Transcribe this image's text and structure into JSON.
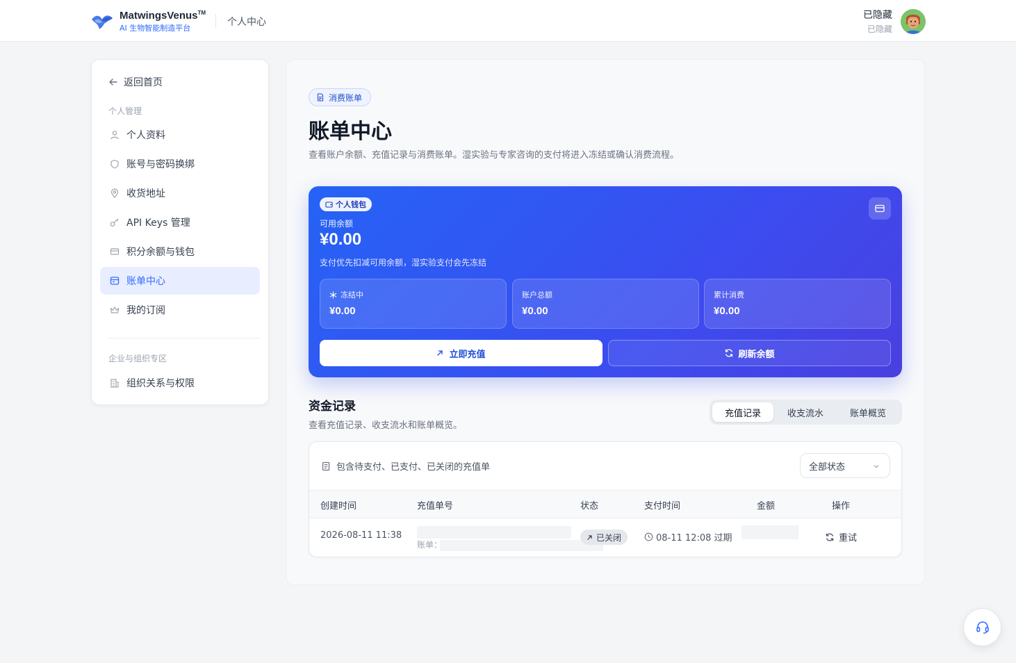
{
  "header": {
    "brand_name": "MatwingsVenus",
    "brand_tm": "TM",
    "brand_sub": "AI 生物智能制造平台",
    "section": "个人中心",
    "user_name": "已隐藏",
    "user_sub": "已隐藏"
  },
  "sidebar": {
    "back": "返回首页",
    "group1": "个人管理",
    "items": [
      {
        "label": "个人资料",
        "icon": "user-icon"
      },
      {
        "label": "账号与密码换绑",
        "icon": "shield-icon"
      },
      {
        "label": "收货地址",
        "icon": "map-pin-icon"
      },
      {
        "label": "API Keys 管理",
        "icon": "key-icon"
      },
      {
        "label": "积分余额与钱包",
        "icon": "credit-card-icon"
      },
      {
        "label": "账单中心",
        "icon": "receipt-icon",
        "active": true
      },
      {
        "label": "我的订阅",
        "icon": "crown-icon"
      }
    ],
    "group2": "企业与组织专区",
    "org_item": {
      "label": "组织关系与权限",
      "icon": "building-icon"
    }
  },
  "main": {
    "tag": "消费账单",
    "title": "账单中心",
    "desc": "查看账户余额、充值记录与消费账单。湿实验与专家咨询的支付将进入冻结或确认消费流程。"
  },
  "wallet": {
    "chip": "个人钱包",
    "balance_label": "可用余额",
    "balance_value": "¥0.00",
    "note": "支付优先扣减可用余额，湿实验支付会先冻结",
    "stats": [
      {
        "label": "冻结中",
        "value": "¥0.00"
      },
      {
        "label": "账户总额",
        "value": "¥0.00"
      },
      {
        "label": "累计消费",
        "value": "¥0.00"
      }
    ],
    "recharge_label": "立即充值",
    "refresh_label": "刷新余额",
    "gradient_start": "#2563f5",
    "gradient_end": "#4a3fe0"
  },
  "funds": {
    "title": "资金记录",
    "desc": "查看充值记录、收支流水和账单概览。",
    "tabs": [
      "充值记录",
      "收支流水",
      "账单概览"
    ],
    "active_tab": "充值记录",
    "filter_note": "包含待支付、已支付、已关闭的充值单",
    "status_filter": "全部状态",
    "columns": [
      "创建时间",
      "充值单号",
      "状态",
      "支付时间",
      "金额",
      "操作"
    ],
    "rows": [
      {
        "created": "2026-08-11 11:38",
        "order_prefix": "账单：",
        "status": "已关闭",
        "pay_time": "08-11 12:08 过期",
        "action": "重试"
      }
    ]
  },
  "colors": {
    "accent": "#2f6bff",
    "active_bg": "#e8eeff"
  }
}
